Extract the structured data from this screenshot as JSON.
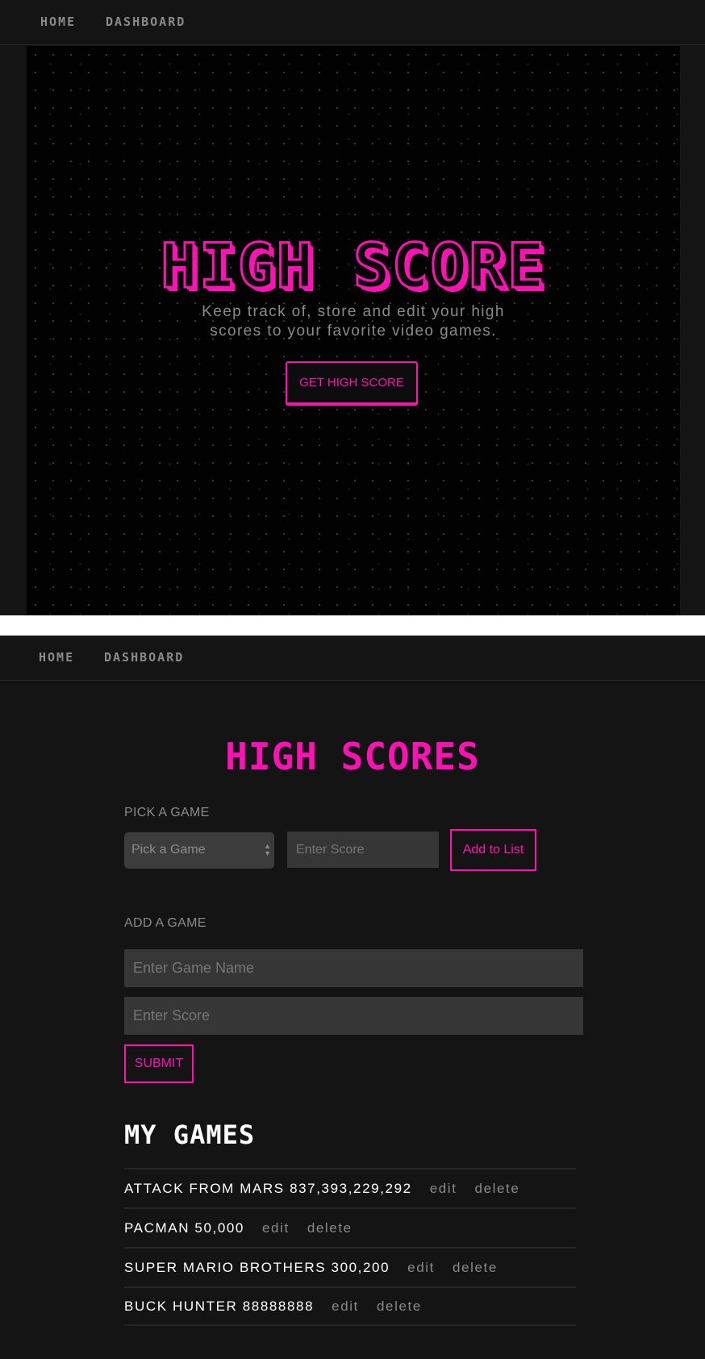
{
  "nav": {
    "home_label": "HOME",
    "dashboard_label": "DASHBOARD"
  },
  "hero": {
    "title": "HIGH SCORE",
    "subtitle": "Keep track of, store and edit your high scores to your favorite video games.",
    "cta_label": "GET HIGH SCORE"
  },
  "dashboard": {
    "title": "HIGH SCORES",
    "pick_section": {
      "label": "PICK A GAME",
      "select_value": "Pick a Game",
      "score_placeholder": "Enter Score",
      "add_label": "Add to List"
    },
    "add_section": {
      "label": "ADD A GAME",
      "name_placeholder": "Enter Game Name",
      "score_placeholder": "Enter Score",
      "submit_label": "SUBMIT"
    },
    "my_games_title": "MY GAMES",
    "games": [
      {
        "entry": "ATTACK FROM MARS 837,393,229,292",
        "edit": "edit",
        "delete": "delete"
      },
      {
        "entry": "PACMAN 50,000",
        "edit": "edit",
        "delete": "delete"
      },
      {
        "entry": "SUPER MARIO BROTHERS 300,200",
        "edit": "edit",
        "delete": "delete"
      },
      {
        "entry": "BUCK HUNTER 88888888",
        "edit": "edit",
        "delete": "delete"
      }
    ]
  },
  "colors": {
    "accent": "#ff12b5",
    "background": "#141414",
    "hero_background": "#020202",
    "muted_text": "#8a8a8a"
  },
  "icons": {
    "select_arrows": "up-down-arrows-icon"
  }
}
